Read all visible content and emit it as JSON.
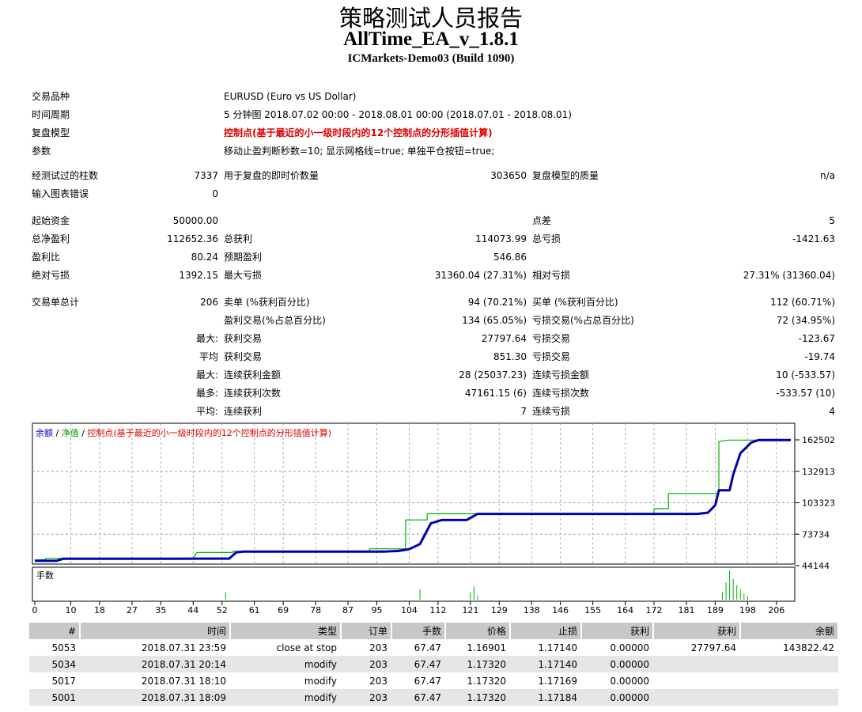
{
  "header": {
    "title": "策略测试人员报告",
    "ea_name": "AllTime_EA_v_1.8.1",
    "server": "ICMarkets-Demo03 (Build 1090)"
  },
  "settings": {
    "symbol_label": "交易品种",
    "symbol_value": "EURUSD (Euro vs US Dollar)",
    "period_label": "时间周期",
    "period_value": "5 分钟图 2018.07.02 00:00 - 2018.08.01 00:00 (2018.07.01 - 2018.08.01)",
    "model_label": "复盘模型",
    "model_value": "控制点(基于最近的小一级时段内的12个控制点的分形插值计算)",
    "params_label": "参数",
    "params_value": "移动止盈判断秒数=10; 显示网格线=true; 单独平仓按钮=true;"
  },
  "stats": {
    "bars_label": "经测试过的柱数",
    "bars_value": "7337",
    "ticks_label": "用于复盘的即时价数量",
    "ticks_value": "303650",
    "quality_label": "复盘模型的质量",
    "quality_value": "n/a",
    "mismatch_label": "输入图表错误",
    "mismatch_value": "0",
    "deposit_label": "起始资金",
    "deposit_value": "50000.00",
    "spread_label": "点差",
    "spread_value": "5",
    "net_label": "总净盈利",
    "net_value": "112652.36",
    "gross_profit_label": "总获利",
    "gross_profit_value": "114073.99",
    "gross_loss_label": "总亏损",
    "gross_loss_value": "-1421.63",
    "pf_label": "盈利比",
    "pf_value": "80.24",
    "expected_label": "预期盈利",
    "expected_value": "546.86",
    "abs_dd_label": "绝对亏损",
    "abs_dd_value": "1392.15",
    "max_dd_label": "最大亏损",
    "max_dd_value": "31360.04 (27.31%)",
    "rel_dd_label": "相对亏损",
    "rel_dd_value": "27.31% (31360.04)",
    "trades_label": "交易单总计",
    "trades_value": "206",
    "short_label": "卖单 (%获利百分比)",
    "short_value": "94 (70.21%)",
    "long_label": "买单 (%获利百分比)",
    "long_value": "112 (60.71%)",
    "profit_trades_label": "盈利交易(%占总百分比)",
    "profit_trades_value": "134 (65.05%)",
    "loss_trades_label": "亏损交易(%占总百分比)",
    "loss_trades_value": "72 (34.95%)",
    "max_prefix": "最大:",
    "largest_profit_label": "获利交易",
    "largest_profit_value": "27797.64",
    "largest_loss_label": "亏损交易",
    "largest_loss_value": "-123.67",
    "avg_prefix": "平均",
    "avg_profit_label": "获利交易",
    "avg_profit_value": "851.30",
    "avg_loss_label": "亏损交易",
    "avg_loss_value": "-19.74",
    "max2_prefix": "最大:",
    "max_cons_profit_label": "连续获利金额",
    "max_cons_profit_value": "28 (25037.23)",
    "max_cons_loss_label": "连续亏损金额",
    "max_cons_loss_value": "10 (-533.57)",
    "most_prefix": "最多:",
    "most_cons_wins_label": "连续获利次数",
    "most_cons_wins_value": "47161.15 (6)",
    "most_cons_losses_label": "连续亏损次数",
    "most_cons_losses_value": "-533.57 (10)",
    "avg2_prefix": "平均:",
    "avg_cons_wins_label": "连续获利",
    "avg_cons_wins_value": "7",
    "avg_cons_losses_label": "连续亏损",
    "avg_cons_losses_value": "4"
  },
  "chart_data": {
    "type": "line",
    "legend": {
      "balance": "余额",
      "sep1": " / ",
      "equity": "净值",
      "sep2": " / ",
      "model": "控制点(基于最近的小一级时段内的12个控制点的分形插值计算)"
    },
    "legend_colors": {
      "balance": "#0000c0",
      "equity": "#00a000",
      "model": "#e00000"
    },
    "x_ticks": [
      0,
      10,
      18,
      27,
      35,
      44,
      52,
      61,
      69,
      78,
      87,
      95,
      104,
      112,
      121,
      129,
      138,
      146,
      155,
      164,
      172,
      181,
      189,
      198,
      206
    ],
    "y_ticks": [
      "162502",
      "132913",
      "103323",
      "73734",
      "44144"
    ],
    "ylim": [
      44144,
      162502
    ],
    "xlim": [
      0,
      210
    ],
    "lot_label": "手数",
    "series": [
      {
        "color": "#00b000",
        "points": [
          [
            0,
            49500
          ],
          [
            3,
            49800
          ],
          [
            3,
            51000
          ],
          [
            44,
            51000
          ],
          [
            45,
            56500
          ],
          [
            55,
            56500
          ],
          [
            55,
            57600
          ],
          [
            93,
            57600
          ],
          [
            93,
            60000
          ],
          [
            103,
            60000
          ],
          [
            103,
            87200
          ],
          [
            109,
            87200
          ],
          [
            109,
            93000
          ],
          [
            153,
            93000
          ],
          [
            172,
            93000
          ],
          [
            172,
            97800
          ],
          [
            176,
            97800
          ],
          [
            176,
            112000
          ],
          [
            180,
            112000
          ],
          [
            185,
            112000
          ],
          [
            190,
            112000
          ],
          [
            190,
            161000
          ],
          [
            193,
            162300
          ],
          [
            210,
            162300
          ]
        ]
      },
      {
        "color": "#0000b0",
        "points": [
          [
            0,
            48700
          ],
          [
            6,
            48700
          ],
          [
            8,
            50700
          ],
          [
            40,
            50700
          ],
          [
            54,
            50800
          ],
          [
            56,
            56700
          ],
          [
            58,
            57300
          ],
          [
            97,
            57300
          ],
          [
            101,
            58000
          ],
          [
            104,
            59600
          ],
          [
            107,
            64500
          ],
          [
            110,
            84000
          ],
          [
            113,
            87000
          ],
          [
            120,
            87200
          ],
          [
            123,
            92800
          ],
          [
            153,
            92800
          ],
          [
            178,
            92800
          ],
          [
            184,
            92800
          ],
          [
            187,
            94000
          ],
          [
            189,
            101000
          ],
          [
            190,
            115000
          ],
          [
            193,
            115000
          ],
          [
            194,
            130000
          ],
          [
            196,
            150000
          ],
          [
            199,
            160000
          ],
          [
            201,
            162300
          ],
          [
            210,
            162300
          ]
        ]
      }
    ],
    "lots": [
      [
        53,
        0.25
      ],
      [
        107,
        0.35
      ],
      [
        121,
        0.25
      ],
      [
        122,
        0.45
      ],
      [
        123,
        0.15
      ],
      [
        191,
        0.25
      ],
      [
        192,
        0.6
      ],
      [
        193,
        1.0
      ],
      [
        194,
        0.7
      ],
      [
        195,
        0.5
      ],
      [
        196,
        0.35
      ],
      [
        197,
        0.2
      ],
      [
        198,
        0.12
      ]
    ]
  },
  "deals": {
    "headers": [
      "#",
      "时间",
      "类型",
      "订单",
      "手数",
      "价格",
      "止损",
      "获利",
      "获利",
      "余额"
    ],
    "rows": [
      [
        "5053",
        "2018.07.31 23:59",
        "close at stop",
        "203",
        "67.47",
        "1.16901",
        "1.17140",
        "0.00000",
        "27797.64",
        "143822.42"
      ],
      [
        "5034",
        "2018.07.31 20:14",
        "modify",
        "203",
        "67.47",
        "1.17320",
        "1.17140",
        "0.00000",
        "",
        ""
      ],
      [
        "5017",
        "2018.07.31 18:10",
        "modify",
        "203",
        "67.47",
        "1.17320",
        "1.17169",
        "0.00000",
        "",
        ""
      ],
      [
        "5001",
        "2018.07.31 18:09",
        "modify",
        "203",
        "67.47",
        "1.17320",
        "1.17184",
        "0.00000",
        "",
        ""
      ]
    ]
  }
}
